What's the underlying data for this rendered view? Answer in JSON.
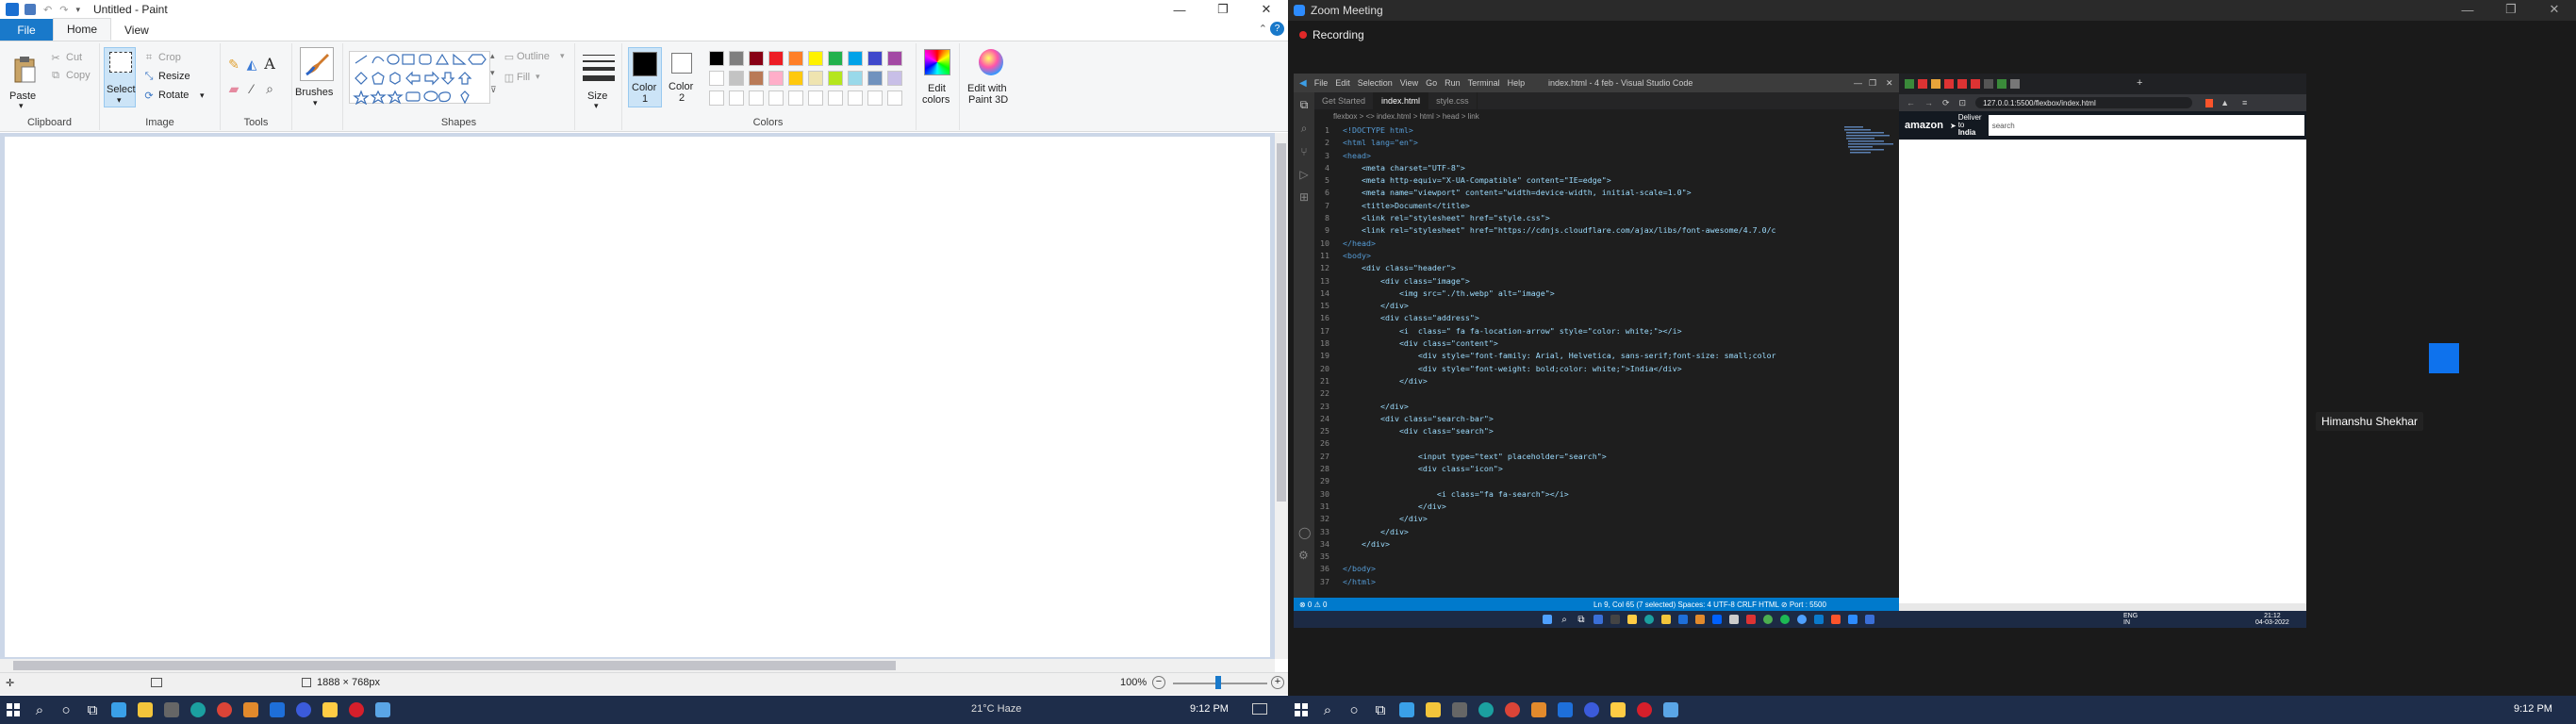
{
  "paint": {
    "title": "Untitled - Paint",
    "window_controls": [
      "—",
      "❐",
      "✕"
    ],
    "tabs": [
      {
        "label": "File"
      },
      {
        "label": "Home"
      },
      {
        "label": "View"
      }
    ],
    "ribbon": {
      "clipboard": {
        "paste": "Paste",
        "cut": "Cut",
        "copy": "Copy",
        "label": "Clipboard"
      },
      "image": {
        "select": "Select",
        "crop": "Crop",
        "resize": "Resize",
        "rotate": "Rotate",
        "label": "Image"
      },
      "tools": {
        "label": "Tools",
        "text_tool": "A"
      },
      "brushes": {
        "label": "Brushes"
      },
      "shapes": {
        "outline": "Outline",
        "fill": "Fill",
        "label": "Shapes"
      },
      "size": {
        "label": "Size"
      },
      "color1": {
        "label_1": "Color",
        "label_2": "1"
      },
      "color2": {
        "label_1": "Color",
        "label_2": "2"
      },
      "colors_label": "Colors",
      "edit_colors": {
        "label_1": "Edit",
        "label_2": "colors"
      },
      "paint3d": {
        "label_1": "Edit with",
        "label_2": "Paint 3D"
      }
    },
    "palette_row1": [
      "#000000",
      "#7f7f7f",
      "#880015",
      "#ed1c24",
      "#ff7f27",
      "#fff200",
      "#22b14c",
      "#00a2e8",
      "#3f48cc",
      "#a349a4"
    ],
    "palette_row2": [
      "#ffffff",
      "#c3c3c3",
      "#b97a57",
      "#ffaec9",
      "#ffc90e",
      "#efe4b0",
      "#b5e61d",
      "#99d9ea",
      "#7092be",
      "#c8bfe7"
    ],
    "status": {
      "dimensions": "1888 × 768px",
      "zoom": "100%"
    }
  },
  "zoom": {
    "title": "Zoom Meeting",
    "recording": "Recording",
    "participant_name": "Himanshu Shekhar",
    "vscode": {
      "title": "index.html - 4 feb - Visual Studio Code",
      "menu": [
        "File",
        "Edit",
        "Selection",
        "View",
        "Go",
        "Run",
        "Terminal",
        "Help"
      ],
      "tabs": [
        "Get Started",
        "index.html",
        "style.css"
      ],
      "breadcrumb": "flexbox > <> index.html > html > head > link",
      "lines": [
        "<!DOCTYPE html>",
        "<html lang=\"en\">",
        "<head>",
        "    <meta charset=\"UTF-8\">",
        "    <meta http-equiv=\"X-UA-Compatible\" content=\"IE=edge\">",
        "    <meta name=\"viewport\" content=\"width=device-width, initial-scale=1.0\">",
        "    <title>Document</title>",
        "    <link rel=\"stylesheet\" href=\"style.css\">",
        "    <link rel=\"stylesheet\" href=\"https://cdnjs.cloudflare.com/ajax/libs/font-awesome/4.7.0/c",
        "</head>",
        "<body>",
        "    <div class=\"header\">",
        "        <div class=\"image\">",
        "            <img src=\"./th.webp\" alt=\"image\">",
        "        </div>",
        "        <div class=\"address\">",
        "            <i  class=\" fa fa-location-arrow\" style=\"color: white;\"></i>",
        "            <div class=\"content\">",
        "                <div style=\"font-family: Arial, Helvetica, sans-serif;font-size: small;color",
        "                <div style=\"font-weight: bold;color: white;\">India</div>",
        "            </div>",
        "",
        "        </div>",
        "        <div class=\"search-bar\">",
        "            <div class=\"search\">",
        "",
        "                <input type=\"text\" placeholder=\"search\">",
        "                <div class=\"icon\">",
        "",
        "                    <i class=\"fa fa-search\"></i>",
        "                </div>",
        "            </div>",
        "        </div>",
        "    </div>",
        "",
        "</body>",
        "</html>"
      ],
      "status_left": "⊗ 0 ⚠ 0",
      "status_right": "Ln 9, Col 65 (7 selected)   Spaces: 4   UTF-8   CRLF   HTML   ⊘ Port : 5500"
    },
    "browser": {
      "url": "127.0.0.1:5500/flexbox/index.html",
      "logo": "amazon",
      "deliver_1": "Deliver",
      "deliver_2": "to",
      "deliver_3": "India",
      "search_placeholder": "search"
    },
    "inner_taskbar": {
      "lang_1": "ENG",
      "lang_2": "IN",
      "time": "21:12",
      "date": "04-03-2022"
    }
  },
  "taskbar_left": {
    "weather": "21°C  Haze",
    "time": "9:12 PM"
  },
  "taskbar_right": {
    "time": "9:12 PM"
  }
}
